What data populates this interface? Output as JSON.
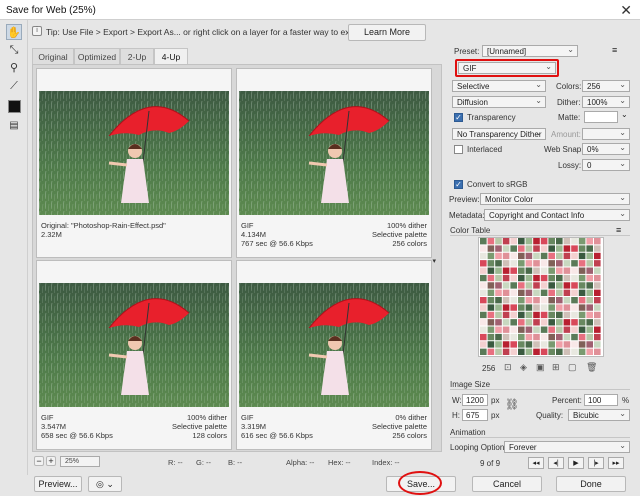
{
  "window": {
    "title": "Save for Web (25%)"
  },
  "tip": {
    "icon": "info-icon",
    "text": "Tip: Use File > Export > Export As... or right click on a layer for a faster way to export assets",
    "learn_more": "Learn More"
  },
  "tabs": [
    {
      "label": "Original"
    },
    {
      "label": "Optimized"
    },
    {
      "label": "2-Up"
    },
    {
      "label": "4-Up"
    }
  ],
  "panes": [
    {
      "left1": "Original: \"Photoshop-Rain-Effect.psd\"",
      "right1": "",
      "left2": "2.32M",
      "right2": "",
      "left3": "",
      "right3": ""
    },
    {
      "left1": "GIF",
      "right1": "100% dither",
      "left2": "4.134M",
      "right2": "Selective palette",
      "left3": "767 sec @ 56.6 Kbps",
      "right3": "256 colors"
    },
    {
      "left1": "GIF",
      "right1": "100% dither",
      "left2": "3.547M",
      "right2": "Selective palette",
      "left3": "658 sec @ 56.6 Kbps",
      "right3": "128 colors"
    },
    {
      "left1": "GIF",
      "right1": "0% dither",
      "left2": "3.319M",
      "right2": "Selective palette",
      "left3": "616 sec @ 56.6 Kbps",
      "right3": "256 colors"
    }
  ],
  "statusbar": {
    "zoom": "25%",
    "r": "R: --",
    "g": "G: --",
    "b": "B: --",
    "alpha": "Alpha: --",
    "hex": "Hex: --",
    "index": "Index: --"
  },
  "settings": {
    "preset_label": "Preset:",
    "preset_value": "[Unnamed]",
    "format": "GIF",
    "reduction": "Selective",
    "colors_label": "Colors:",
    "colors_value": "256",
    "dither_algo": "Diffusion",
    "dither_label": "Dither:",
    "dither_value": "100%",
    "transparency_label": "Transparency",
    "matte_label": "Matte:",
    "trans_dither": "No Transparency Dither",
    "amount_label": "Amount:",
    "interlaced_label": "Interlaced",
    "websnap_label": "Web Snap:",
    "websnap_value": "0%",
    "lossy_label": "Lossy:",
    "lossy_value": "0",
    "convert_label": "Convert to sRGB",
    "preview_label": "Preview:",
    "preview_value": "Monitor Color",
    "metadata_label": "Metadata:",
    "metadata_value": "Copyright and Contact Info"
  },
  "color_table": {
    "title": "Color Table",
    "count": "256"
  },
  "image_size": {
    "title": "Image Size",
    "w_label": "W:",
    "w_value": "1200",
    "h_label": "H:",
    "h_value": "675",
    "unit": "px",
    "percent_label": "Percent:",
    "percent_value": "100",
    "percent_unit": "%",
    "quality_label": "Quality:",
    "quality_value": "Bicubic"
  },
  "animation": {
    "title": "Animation",
    "looping_label": "Looping Options:",
    "looping_value": "Forever",
    "frame": "9 of 9"
  },
  "buttons": {
    "preview": "Preview...",
    "save": "Save...",
    "cancel": "Cancel",
    "done": "Done"
  },
  "colors": {
    "highlight": "#e01010",
    "accent": "#3b6fb0",
    "umbrella": "#e8202c"
  }
}
